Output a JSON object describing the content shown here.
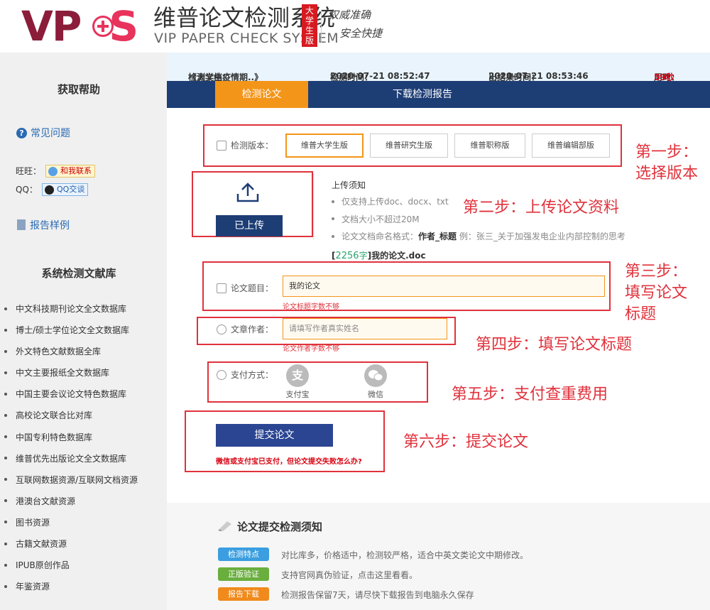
{
  "header": {
    "logo_vp": "VP",
    "logo_s": "S",
    "system_name": "维普论文检测系统",
    "system_name_en": "VIP PAPER CHECK SYSTEM",
    "edition": "大学生版",
    "slogan_1": "权威准确",
    "slogan_2": "安全快捷"
  },
  "sidebar": {
    "help_title": "获取帮助",
    "faq_label": "常见问题",
    "wangwang_label": "旺旺：",
    "wangwang_button": "和我联系",
    "qq_label": "QQ：",
    "qq_button": "QQ交谈",
    "sample_label": "报告样例",
    "db_title": "系统检测文献库",
    "db_items": [
      "中文科技期刊论文全文数据库",
      "博士/硕士学位论文全文数据库",
      "外文特色文献数据全库",
      "中文主要报纸全文数据库",
      "中国主要会议论文特色数据库",
      "高校论文联合比对库",
      "中国专利特色数据库",
      "维普优先出版论文全文数据库",
      "互联网数据资源/互联网文档资源",
      "港澳台文献资源",
      "图书资源",
      "古籍文献资源",
      "IPUB原创作品",
      "年鉴资源"
    ]
  },
  "infobar": {
    "doc_label": "检测文档：",
    "doc_value": "《大学生疫情期..》",
    "check_time_label": "检测时间：",
    "check_time_value": "2020-07-21 08:52:47",
    "result_time_label": "出结果时间：",
    "result_time_value": "2020-07-21 08:53:46",
    "duration_label": "用时：",
    "duration_value": "59秒"
  },
  "nav": {
    "tab_check": "检测论文",
    "tab_download": "下载检测报告"
  },
  "form": {
    "version_label": "检测版本：",
    "versions": [
      "维普大学生版",
      "维普研究生版",
      "维普职称版",
      "维普编辑部版"
    ],
    "selected_version": "维普大学生版",
    "upload_button": "已上传",
    "notice_title": "上传须知",
    "notice_1": "仅支持上传doc、docx、txt",
    "notice_2": "文档大小不超过20M",
    "notice_3_prefix": "论文文档命名格式：",
    "notice_3_bold": "作者_标题",
    "notice_3_suffix": " 例：张三_关于加强发电企业内部控制的思考",
    "file_count": "2256",
    "file_unit": "字",
    "file_name": "我的论文.doc",
    "title_label": "论文题目：",
    "title_value": "我的论文",
    "title_error": "论文标题字数不够",
    "author_label": "文章作者：",
    "author_placeholder": "请填写作者真实姓名",
    "author_error": "论文作者字数不够",
    "pay_label": "支付方式：",
    "pay_alipay_glyph": "支",
    "pay_alipay": "支付宝",
    "pay_wechat": "微信",
    "submit_button": "提交论文",
    "fail_note": "微信或支付宝已支付，但论文提交失败怎么办?"
  },
  "steps": {
    "step1_a": "第一步：",
    "step1_b": "选择版本",
    "step2": "第二步：上传论文资料",
    "step3_a": "第三步：",
    "step3_b": "填写论文",
    "step3_c": "标题",
    "step4": "第四步：填写论文标题",
    "step5": "第五步：支付查重费用",
    "step6": "第六步：提交论文"
  },
  "bottom": {
    "title": "论文提交检测须知",
    "tags": [
      {
        "label": "检测特点",
        "color": "#3a9ee0",
        "text": "对比库多，价格适中，检测较严格，适合中英文类论文中期修改。"
      },
      {
        "label": "正版验证",
        "color": "#6aae3e",
        "text": "支持官网真伪验证，点击这里看看。"
      },
      {
        "label": "报告下载",
        "color": "#f08a1c",
        "text": "检测报告保留7天，请尽快下载报告到电脑永久保存"
      }
    ]
  },
  "colors": {
    "navy": "#1d3d75",
    "orange": "#f39518",
    "annotation_red": "#e0323c",
    "brand_red": "#d7000f"
  }
}
